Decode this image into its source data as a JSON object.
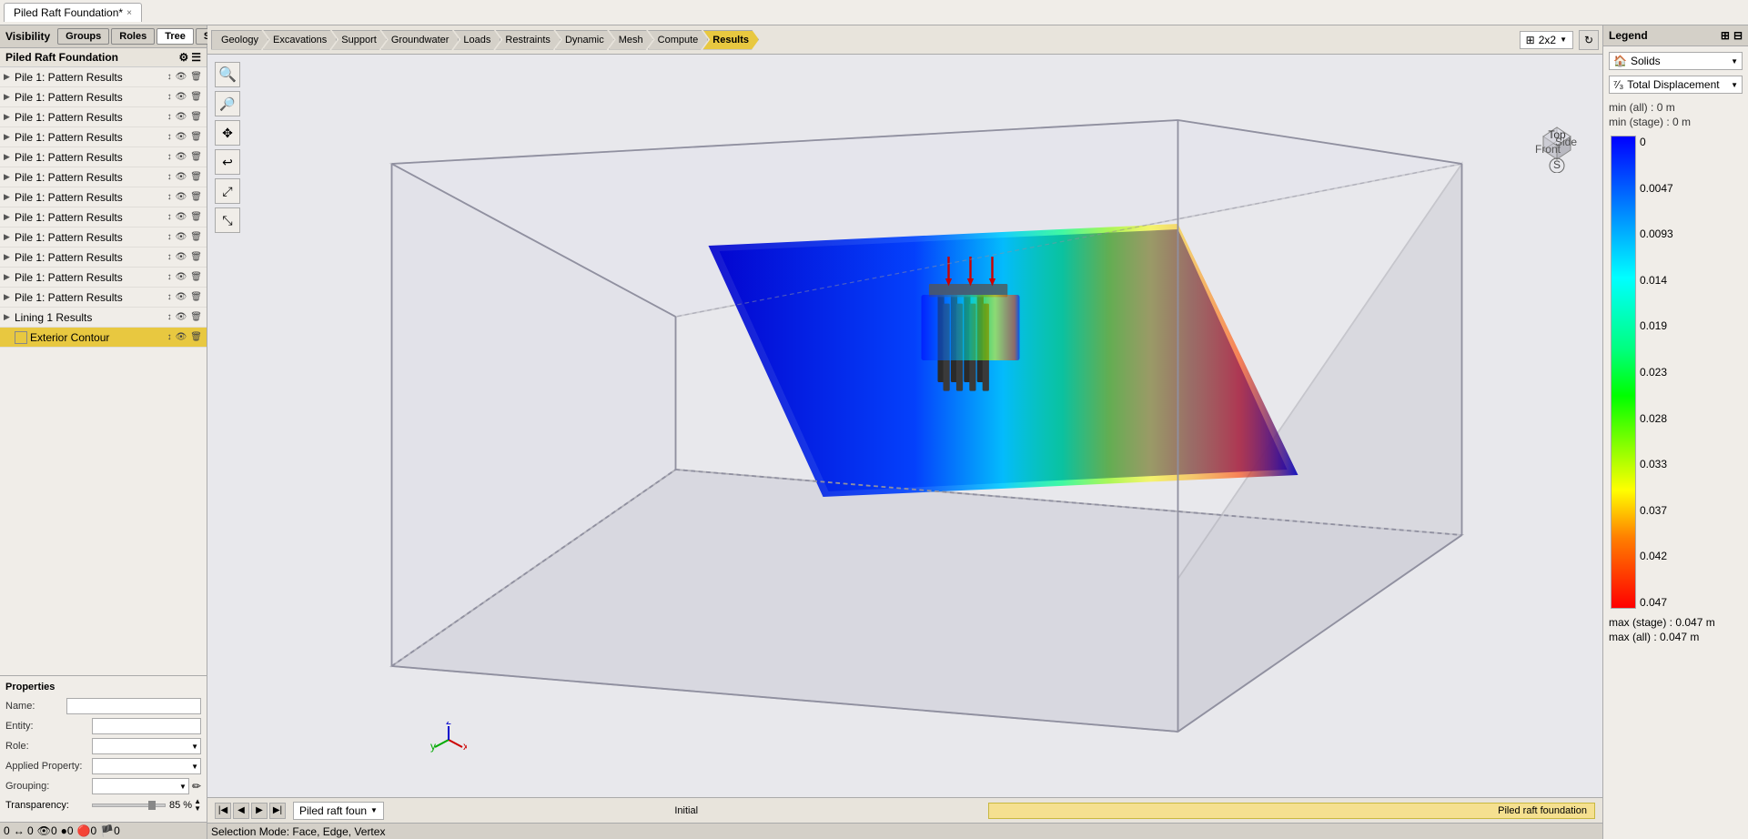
{
  "app": {
    "tab_label": "Piled Raft Foundation*",
    "tab_close": "×"
  },
  "visibility": {
    "title": "Visibility",
    "tabs": [
      "Groups",
      "Roles",
      "Tree",
      "Selection"
    ],
    "active_tab": "Tree",
    "piled_raft_label": "Piled Raft Foundation",
    "tree_items": [
      {
        "label": "Pile 1: Pattern  Results",
        "selected": false
      },
      {
        "label": "Pile 1: Pattern  Results",
        "selected": false
      },
      {
        "label": "Pile 1: Pattern  Results",
        "selected": false
      },
      {
        "label": "Pile 1: Pattern  Results",
        "selected": false
      },
      {
        "label": "Pile 1: Pattern  Results",
        "selected": false
      },
      {
        "label": "Pile 1: Pattern  Results",
        "selected": false
      },
      {
        "label": "Pile 1: Pattern  Results",
        "selected": false
      },
      {
        "label": "Pile 1: Pattern  Results",
        "selected": false
      },
      {
        "label": "Pile 1: Pattern  Results",
        "selected": false
      },
      {
        "label": "Pile 1: Pattern  Results",
        "selected": false
      },
      {
        "label": "Pile 1: Pattern  Results",
        "selected": false
      },
      {
        "label": "Pile 1: Pattern  Results",
        "selected": false
      },
      {
        "label": "Lining 1 Results",
        "selected": false
      },
      {
        "label": "Exterior Contour",
        "selected": true
      }
    ]
  },
  "properties": {
    "title": "Properties",
    "name_label": "Name:",
    "entity_label": "Entity:",
    "role_label": "Role:",
    "applied_prop_label": "Applied Property:",
    "grouping_label": "Grouping:",
    "transparency_label": "Transparency:",
    "transparency_value": "85 %"
  },
  "workflow": {
    "steps": [
      "Geology",
      "Excavations",
      "Support",
      "Groundwater",
      "Loads",
      "Restraints",
      "Dynamic",
      "Mesh",
      "Compute",
      "Results"
    ],
    "active_step": "Results",
    "grid_label": "2x2"
  },
  "toolbar": {
    "tools": [
      "🔍+",
      "🔍-",
      "✋",
      "↩",
      "⤢",
      "⤡"
    ]
  },
  "legend": {
    "title": "Legend",
    "display_mode_label": "Solids",
    "result_type_label": "Total Displacement",
    "min_all_label": "min (all) :",
    "min_all_value": "0 m",
    "min_stage_label": "min (stage) :",
    "min_stage_value": "0 m",
    "color_labels": [
      "0",
      "0.0047",
      "0.0093",
      "0.014",
      "0.019",
      "0.023",
      "0.028",
      "0.033",
      "0.037",
      "0.042",
      "0.047"
    ],
    "max_stage_label": "max (stage) : 0.047 m",
    "max_all_label": "max (all) : 0.047 m"
  },
  "status_bar": {
    "phase_label": "Piled raft foun",
    "center_label": "Initial",
    "right_label": "Piled raft foundation",
    "coords": [
      "0",
      "0",
      "0",
      "0",
      "0"
    ]
  }
}
